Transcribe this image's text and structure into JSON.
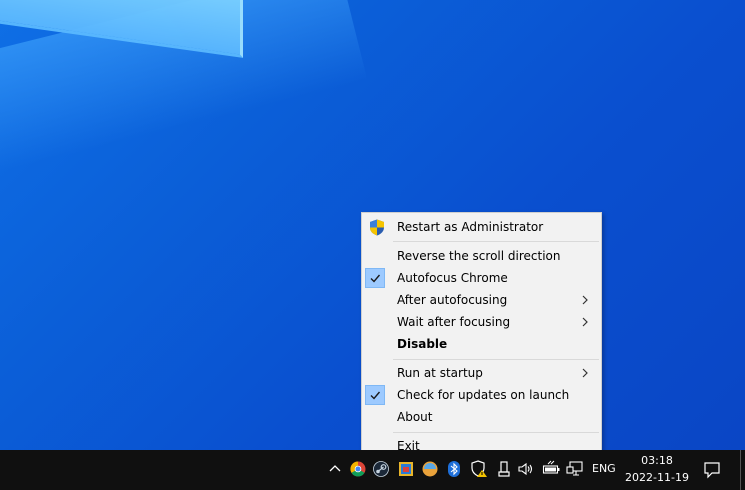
{
  "menu": {
    "items": [
      {
        "label": "Restart as Administrator",
        "icon": "uac-shield-icon"
      },
      {
        "label": "Reverse the scroll direction"
      },
      {
        "label": "Autofocus Chrome",
        "checked": true
      },
      {
        "label": "After autofocusing",
        "submenu": true
      },
      {
        "label": "Wait after focusing",
        "submenu": true
      },
      {
        "label": "Disable",
        "bold": true
      },
      {
        "label": "Run at startup",
        "submenu": true
      },
      {
        "label": "Check for updates on launch",
        "checked": true
      },
      {
        "label": "About"
      },
      {
        "label": "Exit"
      }
    ]
  },
  "taskbar": {
    "tray_icons": [
      "chevron-up-icon",
      "chrome-icon",
      "steam-icon",
      "app-icon",
      "cloud-app-icon",
      "bluetooth-icon",
      "security-warning-icon",
      "usb-eject-icon",
      "volume-icon",
      "battery-icon",
      "network-icon"
    ],
    "language": "ENG",
    "time": "03:18",
    "date": "2022-11-19"
  },
  "colors": {
    "desktop_blue": "#0b5fd8",
    "menu_bg": "#f2f2f2",
    "check_bg": "#9dcaff",
    "taskbar_bg": "#101010"
  }
}
